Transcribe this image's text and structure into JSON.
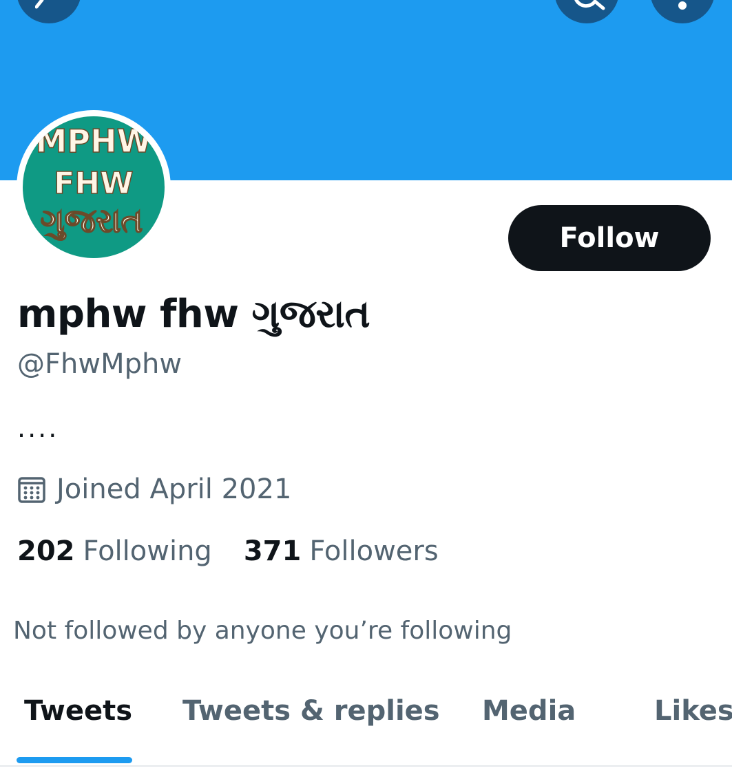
{
  "colors": {
    "banner": "#1d9bf0",
    "avatar_bg": "#0f9a84",
    "avatar_text": "#fff6e6",
    "follow_bg": "#0f1419",
    "accent": "#1d9bf0",
    "icon_button_bg": "#16568a"
  },
  "header": {
    "back_icon": "back-arrow-icon",
    "search_icon": "search-icon",
    "more_icon": "more-options-icon"
  },
  "profile": {
    "avatar": {
      "line1": "MPHW",
      "line2": "FHW",
      "line3": "ગુજરાત"
    },
    "follow_label": "Follow",
    "display_name": "mphw fhw ગુજરાત",
    "handle": "@FhwMphw",
    "bio": "....",
    "joined_icon": "calendar-icon",
    "joined": "Joined April 2021",
    "following_count": "202",
    "following_label": "Following",
    "followers_count": "371",
    "followers_label": "Followers",
    "mutuals_text": "Not followed by anyone you’re following"
  },
  "tabs": [
    {
      "label": "Tweets",
      "active": true
    },
    {
      "label": "Tweets & replies",
      "active": false
    },
    {
      "label": "Media",
      "active": false
    },
    {
      "label": "Likes",
      "active": false
    }
  ]
}
